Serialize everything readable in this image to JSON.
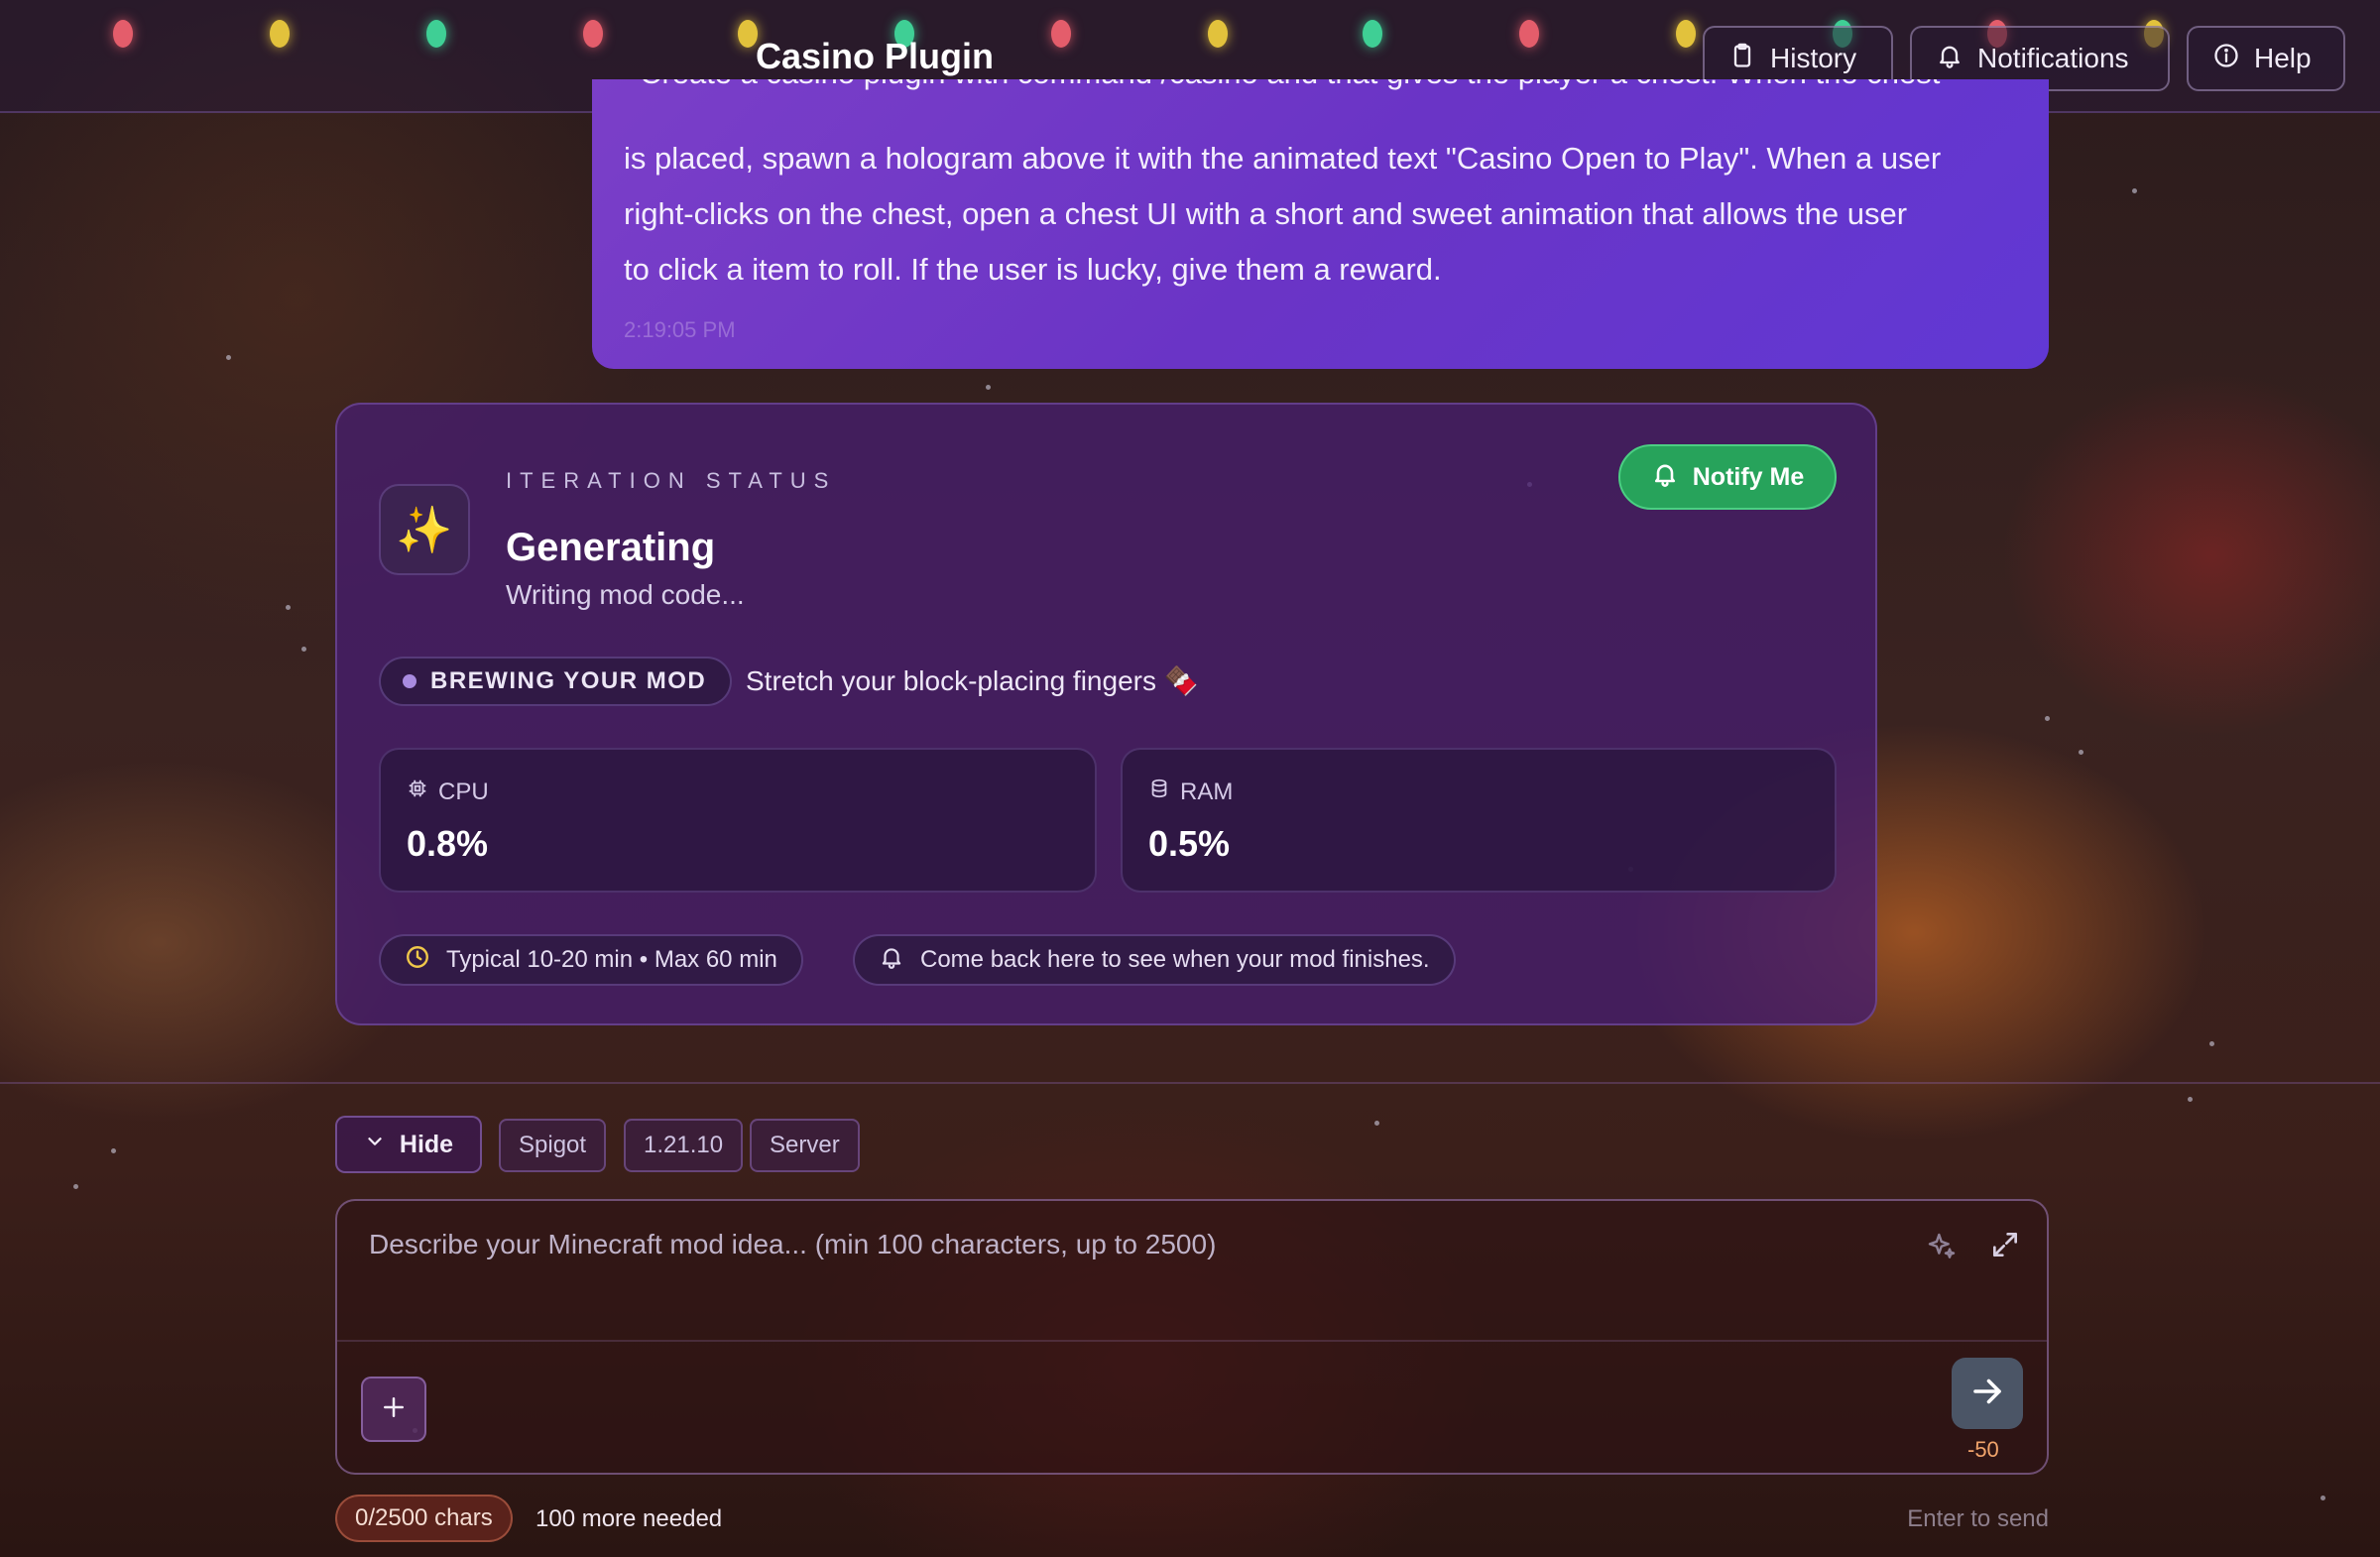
{
  "header": {
    "title": "Casino Plugin",
    "buttons": {
      "history": "History",
      "notifications": "Notifications",
      "help": "Help"
    }
  },
  "message": {
    "cut_line": "Create a casino plugin with command /casino and that gives the player a chest. When the chest",
    "lines": [
      "is placed, spawn a hologram above it with the animated text \"Casino Open to Play\". When a user",
      "right-clicks on the chest, open a chest UI with a short and sweet animation that allows the user",
      "to click a item to roll. If the user is lucky, give them a reward."
    ],
    "time": "2:19:05 PM"
  },
  "status": {
    "label": "ITERATION STATUS",
    "title": "Generating",
    "subtitle": "Writing mod code...",
    "icon": "sparkles-icon",
    "notify_label": "Notify Me",
    "brewing_label": "BREWING YOUR MOD",
    "brewing_text": "Stretch your block-placing fingers 🍫",
    "cpu": {
      "label": "CPU",
      "value": "0.8%"
    },
    "ram": {
      "label": "RAM",
      "value": "0.5%"
    },
    "timing": "Typical 10-20 min • Max 60 min",
    "comeback": "Come back here to see when your mod finishes."
  },
  "composer": {
    "hide_label": "Hide",
    "chips": [
      "Spigot",
      "1.21.10",
      "Server"
    ],
    "placeholder": "Describe your Minecraft mod idea... (min 100 characters, up to 2500)",
    "send_count": "-50",
    "char_count": "0/2500 chars",
    "more_needed": "100 more needed",
    "enter_hint": "Enter to send"
  },
  "colors": {
    "accent": "#7b3fc8",
    "notify_green": "#27a35b",
    "warning": "#f1a46b"
  }
}
